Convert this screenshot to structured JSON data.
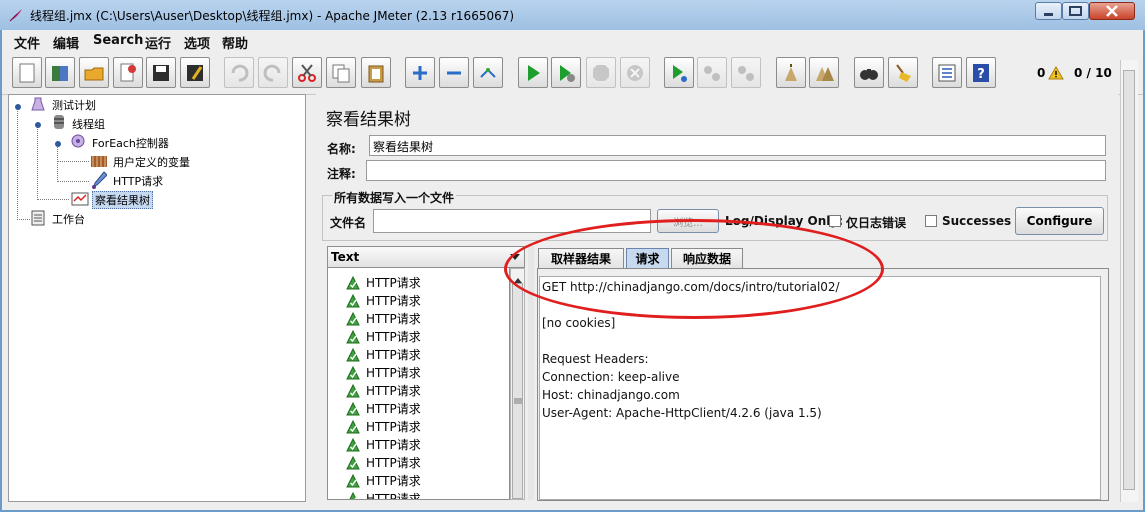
{
  "window": {
    "title": "线程组.jmx (C:\\Users\\Auser\\Desktop\\线程组.jmx) - Apache JMeter (2.13 r1665067)"
  },
  "menu": [
    "文件",
    "编辑",
    "Search",
    "运行",
    "选项",
    "帮助"
  ],
  "toolbar": {
    "buttons": [
      "new-icon",
      "templates-icon",
      "open-icon",
      "close-icon",
      "save-icon",
      "save-as-icon",
      "undo-icon",
      "redo-icon",
      "cut-icon",
      "copy-icon",
      "paste-icon",
      "expand-icon",
      "collapse-icon",
      "toggle-icon",
      "start-icon",
      "start-no-pause-icon",
      "stop-icon",
      "shutdown-icon",
      "remote-start-icon",
      "remote-stop-icon",
      "remote-shutdown-icon",
      "clear-icon",
      "clear-all-icon",
      "search-icon",
      "reset-search-icon",
      "function-helper-icon",
      "help-icon"
    ],
    "error_count": "0",
    "thread_count": "0 / 10"
  },
  "tree": {
    "nodes": [
      "测试计划",
      "线程组",
      "ForEach控制器",
      "用户定义的变量",
      "HTTP请求",
      "察看结果树",
      "工作台"
    ]
  },
  "panel": {
    "title": "察看结果树",
    "name_label": "名称:",
    "name_value": "察看结果树",
    "comment_label": "注释:",
    "comment_value": "",
    "file_group_label": "所有数据写入一个文件",
    "filename_label": "文件名",
    "filename_value": "",
    "browse_label": "浏览...",
    "log_display_label": "Log/Display Only:",
    "errors_only_label": "仅日志错误",
    "successes_label": "Successes",
    "configure_label": "Configure"
  },
  "results": {
    "renderer": "Text",
    "samples": [
      "HTTP请求",
      "HTTP请求",
      "HTTP请求",
      "HTTP请求",
      "HTTP请求",
      "HTTP请求",
      "HTTP请求",
      "HTTP请求",
      "HTTP请求",
      "HTTP请求",
      "HTTP请求",
      "HTTP请求",
      "HTTP请求"
    ]
  },
  "tabs": [
    "取样器结果",
    "请求",
    "响应数据"
  ],
  "active_tab": "请求",
  "request": {
    "lines": [
      "GET http://chinadjango.com/docs/intro/tutorial02/",
      "",
      "[no cookies]",
      "",
      "Request Headers:",
      "Connection: keep-alive",
      "Host: chinadjango.com",
      "User-Agent: Apache-HttpClient/4.2.6 (java 1.5)"
    ]
  },
  "colors": {
    "success_icon": "#3da23d",
    "annotation": "#e11e1e",
    "selected_node": "#c5d9f1"
  }
}
